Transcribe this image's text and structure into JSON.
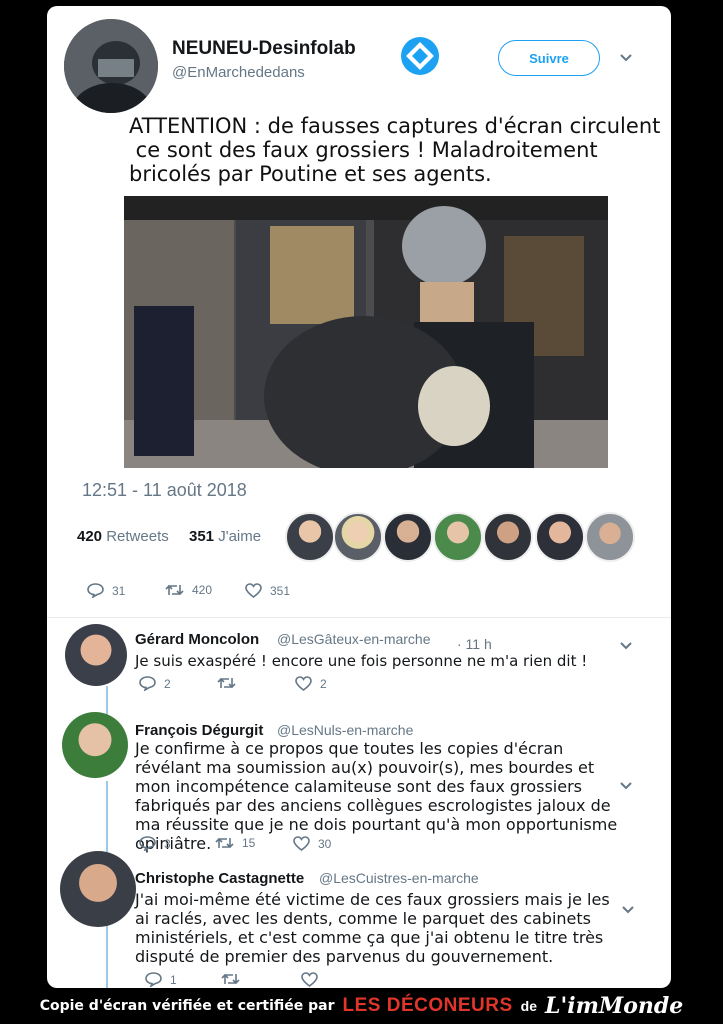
{
  "tweet": {
    "author_name": "NEUNEU-Desinfolab",
    "author_handle": "@EnMarchededans",
    "follow_label": "Suivre",
    "text_lines": [
      "ATTENTION : de fausses captures d'écran circulent",
      " ce sont des faux grossiers ! Maladroitement",
      "bricolés par Poutine et ses agents."
    ],
    "timestamp": "12:51 - 11 août 2018",
    "retweets_count": "420",
    "retweets_label": "Retweets",
    "likes_count": "351",
    "likes_label": "J'aime",
    "actions": {
      "replies": "31",
      "retweets": "420",
      "likes": "351"
    }
  },
  "replies": [
    {
      "name": "Gérard Moncolon",
      "handle": "@LesGâteux-en-marche",
      "time": "· 11 h",
      "text": "Je suis exaspéré ! encore une fois personne ne m'a rien dit !",
      "actions": {
        "replies": "2",
        "retweets": "",
        "likes": "2"
      }
    },
    {
      "name": "François Dégurgit",
      "handle": "@LesNuls-en-marche",
      "text": "Je confirme à ce propos que toutes les copies d'écran révélant ma soumission au(x) pouvoir(s), mes bourdes et mon incompétence calamiteuse sont des faux grossiers fabriqués par des anciens collègues escrologistes jaloux de ma réussite que je ne dois pourtant qu'à mon opportunisme opiniâtre.",
      "actions": {
        "replies": "3",
        "retweets": "15",
        "likes": "30"
      }
    },
    {
      "name": "Christophe Castagnette",
      "handle": "@LesCuistres-en-marche",
      "text": "J'ai moi-même été victime de ces faux grossiers mais je les ai raclés, avec les dents, comme le parquet des cabinets ministériels, et c'est comme ça que j'ai obtenu le titre très disputé de premier des parvenus du gouvernement.",
      "actions": {
        "replies": "1",
        "retweets": "",
        "likes": ""
      }
    }
  ],
  "footer": {
    "prefix": "Copie d'écran vérifiée et certifiée par",
    "brand1": "LES DÉCONEURS",
    "middle": "de",
    "brand2": "L'imMonde"
  },
  "colors": {
    "accent": "#1da1f2",
    "muted": "#657786",
    "footer_red": "#e0352b"
  }
}
